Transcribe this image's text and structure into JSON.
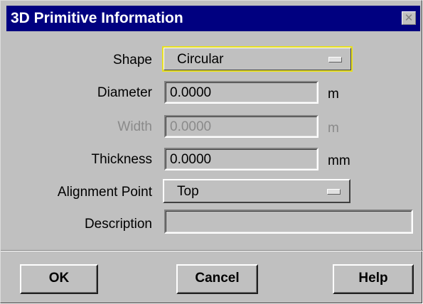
{
  "window": {
    "title": "3D Primitive Information",
    "close_icon": "close-icon"
  },
  "form": {
    "shape": {
      "label": "Shape",
      "value": "Circular"
    },
    "diameter": {
      "label": "Diameter",
      "value": "0.0000",
      "unit": "m"
    },
    "width": {
      "label": "Width",
      "value": "0.0000",
      "unit": "m",
      "disabled": true
    },
    "thickness": {
      "label": "Thickness",
      "value": "0.0000",
      "unit": "mm"
    },
    "alignment": {
      "label": "Alignment Point",
      "value": "Top"
    },
    "description": {
      "label": "Description",
      "value": ""
    }
  },
  "buttons": {
    "ok": "OK",
    "cancel": "Cancel",
    "help": "Help"
  }
}
